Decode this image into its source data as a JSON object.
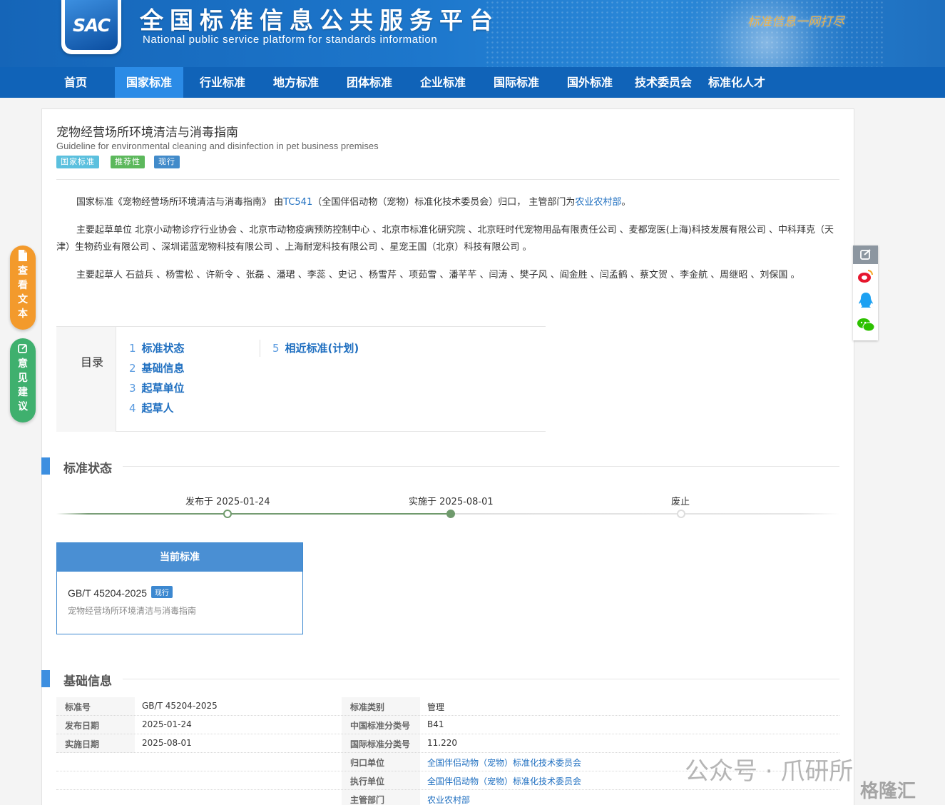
{
  "header": {
    "logo_text": "SAC",
    "title": "全国标准信息公共服务平台",
    "subtitle": "National public service platform  for standards information",
    "slogan": "标准信息一网打尽"
  },
  "nav": [
    {
      "label": "首页"
    },
    {
      "label": "国家标准"
    },
    {
      "label": "行业标准"
    },
    {
      "label": "地方标准"
    },
    {
      "label": "团体标准"
    },
    {
      "label": "企业标准"
    },
    {
      "label": "国际标准"
    },
    {
      "label": "国外标准"
    },
    {
      "label": "技术委员会"
    },
    {
      "label": "标准化人才"
    }
  ],
  "standard": {
    "title_cn": "宠物经营场所环境清洁与消毒指南",
    "title_en": "Guideline for environmental cleaning and disinfection in pet business premises",
    "tags": [
      "国家标准",
      "推荐性",
      "现行"
    ],
    "tag_colors": [
      "#5bc0de",
      "#5cb85c",
      "#428bca"
    ]
  },
  "intro": {
    "p1_a": "国家标准《宠物经营场所环境清洁与消毒指南》 由",
    "p1_tc": "TC541",
    "p1_b": "（全国伴侣动物（宠物）标准化技术委员会）归口， 主管部门为",
    "p1_dept": "农业农村部",
    "p1_end": "。",
    "p2": "主要起草单位 北京小动物诊疗行业协会 、北京市动物疫病预防控制中心 、北京市标准化研究院 、北京旺时代宠物用品有限责任公司 、麦都宠医(上海)科技发展有限公司 、中科拜克（天津）生物药业有限公司 、深圳诺蓝宠物科技有限公司 、上海耐宠科技有限公司 、星宠王国（北京）科技有限公司 。",
    "p3": "主要起草人 石益兵 、杨雪松 、许新令 、张磊 、潘珺 、李蕊 、史记 、杨雪芹 、项茹雪 、潘芊芊 、闫涛 、樊子风 、阎金胜 、闫孟鹤 、蔡文贺 、李金航 、周继昭 、刘保国 。"
  },
  "toc": {
    "label": "目录",
    "items": [
      {
        "num": "1",
        "label": "标准状态"
      },
      {
        "num": "2",
        "label": "基础信息"
      },
      {
        "num": "3",
        "label": "起草单位"
      },
      {
        "num": "4",
        "label": "起草人"
      },
      {
        "num": "5",
        "label": "相近标准(计划)"
      }
    ]
  },
  "status": {
    "section_title": "标准状态",
    "published": "发布于 2025-01-24",
    "implemented": "实施于 2025-08-01",
    "abolished": "废止",
    "current_head": "当前标准",
    "current_code": "GB/T 45204-2025",
    "current_tag": "现行",
    "current_name": "宠物经营场所环境清洁与消毒指南"
  },
  "basic": {
    "section_title": "基础信息",
    "rows": [
      {
        "k1": "标准号",
        "v1": "GB/T 45204-2025",
        "k2": "标准类别",
        "v2": "管理"
      },
      {
        "k1": "发布日期",
        "v1": "2025-01-24",
        "k2": "中国标准分类号",
        "v2": "B41"
      },
      {
        "k1": "实施日期",
        "v1": "2025-08-01",
        "k2": "国际标准分类号",
        "v2": "11.220"
      },
      {
        "k1": "",
        "v1": "",
        "k2": "归口单位",
        "v2": "全国伴侣动物（宠物）标准化技术委员会"
      },
      {
        "k1": "",
        "v1": "",
        "k2": "执行单位",
        "v2": "全国伴侣动物（宠物）标准化技术委员会"
      },
      {
        "k1": "",
        "v1": "",
        "k2": "主管部门",
        "v2": "农业农村部"
      }
    ]
  },
  "side": {
    "view_text": "查看文本",
    "feedback": "意见建议"
  },
  "watermark": {
    "wechat": "公众号 · 爪研所",
    "brand": "格隆汇"
  }
}
